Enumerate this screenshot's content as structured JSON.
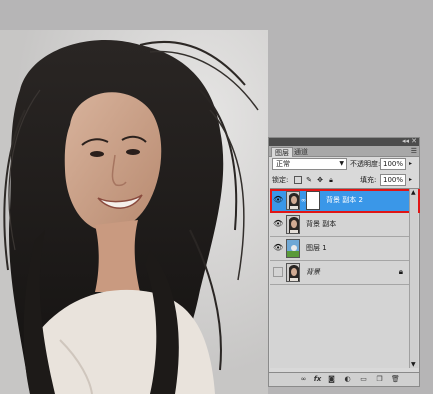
{
  "panel": {
    "tabs": [
      "图层",
      "通道"
    ],
    "menu_icon": "panel-menu-icon",
    "collapse_icon": "collapse-icon",
    "close_icon": "close-icon",
    "blend_mode": "正常",
    "opacity_label": "不透明度:",
    "opacity_value": "100%",
    "lock_label": "锁定:",
    "fill_label": "填充:",
    "fill_value": "100%"
  },
  "layers": [
    {
      "name": "背景 副本 2",
      "visible": true,
      "selected": true,
      "has_mask": true
    },
    {
      "name": "背景 副本",
      "visible": true,
      "selected": false
    },
    {
      "name": "图层 1",
      "visible": true,
      "selected": false
    },
    {
      "name": "背景",
      "visible": false,
      "selected": false,
      "locked": true
    }
  ],
  "colors": {
    "selection": "#3a97e8",
    "highlight_box": "#e01515",
    "panel_bg": "#d9d9d9"
  }
}
